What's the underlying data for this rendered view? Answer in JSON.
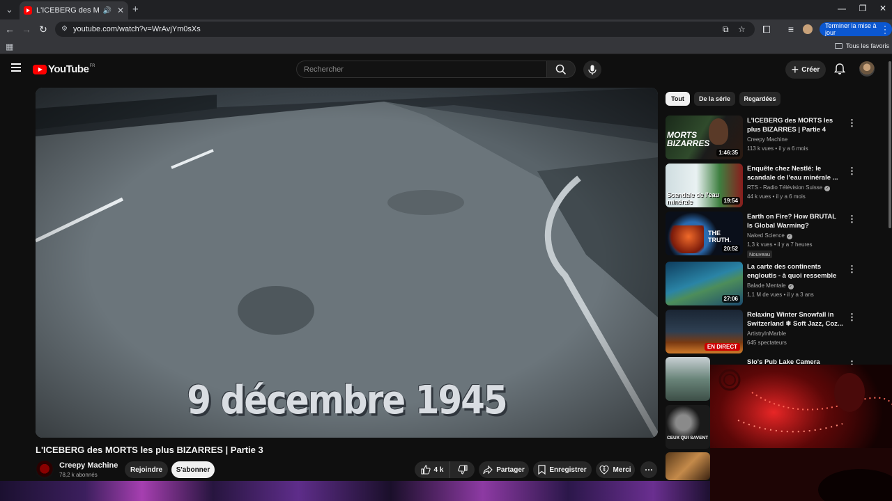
{
  "browser": {
    "tab_title": "L'ICEBERG des MORTS les p",
    "url": "youtube.com/watch?v=WrAvjYm0sXs",
    "update_button": "Terminer la mise à jour",
    "bookmarks_all": "Tous les favoris"
  },
  "header": {
    "logo_text": "YouTube",
    "country_code": "FR",
    "search_placeholder": "Rechercher",
    "create_label": "Créer"
  },
  "player": {
    "caption": "9 décembre 1945"
  },
  "video": {
    "title": "L'ICEBERG des MORTS les plus BIZARRES | Partie 3",
    "channel": "Creepy Machine",
    "subscribers": "78,2 k abonnés",
    "join_label": "Rejoindre",
    "subscribe_label": "S'abonner",
    "likes": "4 k",
    "share_label": "Partager",
    "save_label": "Enregistrer",
    "thanks_label": "Merci"
  },
  "chips": [
    "Tout",
    "De la série",
    "Regardées"
  ],
  "recommendations": [
    {
      "title": "L'ICEBERG des MORTS les plus BIZARRES | Partie 4",
      "channel": "Creepy Machine",
      "meta": "113 k vues • il y a 6 mois",
      "duration": "1:46:35",
      "thumb_text": "MORTS BIZARRES",
      "colors": [
        "#1c2a1c",
        "#c41e1e"
      ]
    },
    {
      "title": "Enquête chez Nestlé: le scandale de l'eau minérale ...",
      "channel": "RTS - Radio Télévision Suisse",
      "meta": "44 k vues • il y a 6 mois",
      "duration": "19:54",
      "thumb_text": "Scandale de l'eau minérale",
      "colors": [
        "#d9e6e8",
        "#3d7a3a"
      ]
    },
    {
      "title": "Earth on Fire? How BRUTAL Is Global Warming?",
      "channel": "Naked Science",
      "meta": "1,3 k vues • il y a 7 heures",
      "duration": "20:52",
      "thumb_text": "THE TRUTH.",
      "badge": "Nouveau",
      "colors": [
        "#1a3a6e",
        "#d2461e"
      ]
    },
    {
      "title": "La carte des continents engloutis - à quoi ressemble la...",
      "channel": "Balade Mentale",
      "meta": "1,1 M de vues • il y a 3 ans",
      "duration": "27:06",
      "colors": [
        "#1f6d8e",
        "#9bc7d4"
      ]
    },
    {
      "title": "Relaxing Winter Snowfall in Switzerland ❄ Soft Jazz, Coz...",
      "channel": "ArtistryInMarble",
      "meta": "645 spectateurs",
      "live": "EN DIRECT",
      "colors": [
        "#1d2a3a",
        "#c26a2a"
      ]
    },
    {
      "title": "Slo's Pub Lake Camera",
      "channel": "",
      "meta": "",
      "colors": [
        "#5b7a6e",
        "#d8dde0"
      ]
    },
    {
      "title": "",
      "channel": "",
      "meta": "",
      "thumb_text": "CEUX QUI SAVENT",
      "colors": [
        "#1d1d1d",
        "#6b6b6b"
      ]
    },
    {
      "title": "",
      "channel": "",
      "meta": "",
      "colors": [
        "#8a5a2a",
        "#d29650"
      ]
    }
  ]
}
